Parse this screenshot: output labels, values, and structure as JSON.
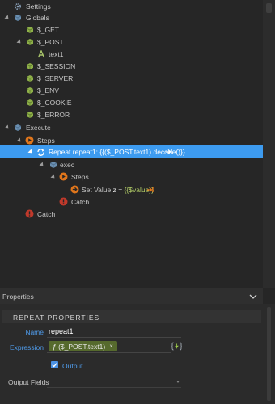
{
  "tree": {
    "items": [
      {
        "label": "Settings",
        "icon": "gear-icon"
      },
      {
        "label": "Globals",
        "icon": "globe-icon"
      },
      {
        "label": "$_GET",
        "icon": "cube-icon"
      },
      {
        "label": "$_POST",
        "icon": "cube-icon"
      },
      {
        "label": "text1",
        "icon": "text-icon"
      },
      {
        "label": "$_SESSION",
        "icon": "cube-icon"
      },
      {
        "label": "$_SERVER",
        "icon": "cube-icon"
      },
      {
        "label": "$_ENV",
        "icon": "cube-icon"
      },
      {
        "label": "$_COOKIE",
        "icon": "cube-icon"
      },
      {
        "label": "$_ERROR",
        "icon": "cube-icon"
      },
      {
        "label": "Execute",
        "icon": "execute-icon"
      },
      {
        "label": "Steps",
        "icon": "play-icon"
      },
      {
        "label": "Repeat repeat1: {{($_POST.text1).decode()}}",
        "icon": "repeat-icon"
      },
      {
        "label": "exec",
        "icon": "cube-icon"
      },
      {
        "label": "Steps",
        "icon": "play-icon"
      },
      {
        "label": "Set Value",
        "value_var": "z",
        "value_eq": "=",
        "value_expr": "{{$value}}",
        "icon": "arrow-right-icon"
      },
      {
        "label": "Catch",
        "icon": "error-icon"
      },
      {
        "label": "Catch",
        "icon": "error-icon"
      }
    ]
  },
  "properties": {
    "panel_title": "Properties",
    "section_title": "REPEAT PROPERTIES",
    "name_label": "Name",
    "name_value": "repeat1",
    "expression_label": "Expression",
    "expression_chip": "ƒ ($_POST.text1)",
    "expression_chip_close": "×",
    "output_checkbox_label": "Output",
    "output_checked": true,
    "output_fields_label": "Output Fields"
  },
  "colors": {
    "selection": "#3d9bf0",
    "label_blue": "#4f9bea",
    "cube_green": "#8fb04a",
    "play_orange": "#e0761c",
    "error_red": "#c0392b",
    "repeat_blue": "#5ab0ff"
  }
}
